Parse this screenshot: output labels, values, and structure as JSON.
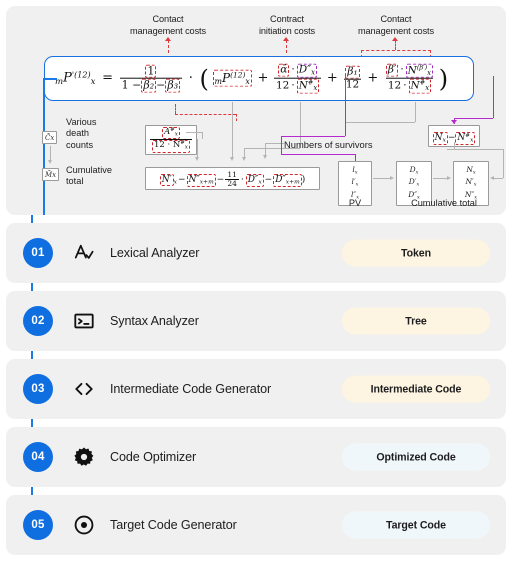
{
  "diagram": {
    "annotations": [
      {
        "id": "a1",
        "line1": "Contact",
        "line2": "management costs"
      },
      {
        "id": "a2",
        "line1": "Contract",
        "line2": "initiation costs"
      },
      {
        "id": "a3",
        "line1": "Contact",
        "line2": "management costs"
      }
    ],
    "legend": [
      {
        "glyph": "C̄x",
        "line1": "Various",
        "line2": "death",
        "line3": "counts"
      },
      {
        "glyph": "M̄x",
        "line1": "Cumulative",
        "line2": "total",
        "line3": ""
      }
    ],
    "inline_labels": {
      "survivors": "Numbers of survivors",
      "pv": "PV",
      "cumulative_total": "Cumulative total"
    },
    "formula": {
      "lhs_pre": "m",
      "lhs_base": "P",
      "lhs_sub": "x",
      "lhs_sup": "'(12)",
      "equals": "=",
      "one": "1",
      "denom_lead": "1 −",
      "beta2": "β₂",
      "minus": "−",
      "beta3": "β₃",
      "dot": "·",
      "term1_pre": "m",
      "term1_base": "P",
      "term1_sub": "x",
      "term1_sup": "(12)",
      "plus": "+",
      "alpha": "ᾱ",
      "Dpp": "D″",
      "Dpp_sub": "x",
      "twelve": "12",
      "Nhash": "N",
      "Nhash_sup": "#",
      "Nhash_sub": "x",
      "beta1": "β₁",
      "betaprime": "β′",
      "Nbeta": "N",
      "Nbeta_sup": "(β′)",
      "Nbeta_sub": "x"
    },
    "sub_expr": {
      "A_over": {
        "num": "A",
        "num_sup": "#",
        "num_sub": "x",
        "den": "12 · N",
        "den_sup": "#",
        "den_sub": "x"
      },
      "long": {
        "t1": "N′",
        "t1_sub": "x",
        "op1": "−",
        "t2": "N″",
        "t2_sub": "x+m",
        "op2": "−",
        "frac_num": "11",
        "frac_den": "24",
        "dot": "·",
        "t3": "D″",
        "t3_sub": "x",
        "op3": "−",
        "t4": "D″",
        "t4_sub": "x+m"
      },
      "nn": {
        "a": "N",
        "a_sub": "x",
        "op": "−",
        "b": "N",
        "b_sup": "#",
        "b_sub": "x"
      }
    },
    "vectors": {
      "pv": [
        "l",
        "l′",
        "l″"
      ],
      "pv_sub": "x",
      "mid": [
        "D",
        "D′",
        "D″"
      ],
      "mid_sub": "x",
      "right": [
        "N",
        "N′",
        "N″"
      ],
      "right_sub": "x"
    },
    "colors": {
      "formula_border": "#1a6fe0",
      "red_dashed": "#d0262c",
      "purple_dashed": "#a32bbf",
      "gray_line": "#b4b4b4",
      "purple_line": "#b32bcc"
    }
  },
  "flow": {
    "accent": "#0f6fe0",
    "steps": [
      {
        "number": "01",
        "icon": "letter-a-check-icon",
        "title": "Lexical Analyzer",
        "badge": "Token",
        "badge_style": "cream"
      },
      {
        "number": "02",
        "icon": "terminal-icon",
        "title": "Syntax Analyzer",
        "badge": "Tree",
        "badge_style": "cream"
      },
      {
        "number": "03",
        "icon": "angle-brackets-icon",
        "title": "Intermediate Code Generator",
        "badge": "Intermediate Code",
        "badge_style": "cream"
      },
      {
        "number": "04",
        "icon": "gear-icon",
        "title": "Code Optimizer",
        "badge": "Optimized Code",
        "badge_style": "ice"
      },
      {
        "number": "05",
        "icon": "target-dot-icon",
        "title": "Target Code Generator",
        "badge": "Target Code",
        "badge_style": "ice"
      }
    ]
  }
}
